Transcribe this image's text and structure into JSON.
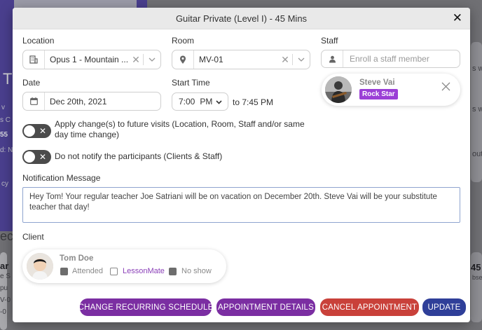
{
  "background": {
    "fragments": [
      "T",
      "v",
      "s C",
      "55",
      "d: N",
      "cy",
      "ec",
      "ar",
      "e S",
      "pu",
      "V-0",
      "-0",
      "s w",
      "s w",
      "out",
      "45",
      "bse"
    ]
  },
  "modal": {
    "title": "Guitar Private (Level I) - 45 Mins",
    "close_label": "✕",
    "location": {
      "label": "Location",
      "value": "Opus 1 - Mountain ...",
      "icon": "building-icon"
    },
    "room": {
      "label": "Room",
      "value": "MV-01",
      "icon": "map-pin-icon"
    },
    "staff": {
      "label": "Staff",
      "placeholder": "Enroll a staff member",
      "member": {
        "name": "Steve Vai",
        "badge": "Rock Star"
      }
    },
    "date": {
      "label": "Date",
      "value": "Dec 20th, 2021",
      "icon": "calendar-icon"
    },
    "start_time": {
      "label": "Start Time",
      "hour": "7:00",
      "ampm": "PM",
      "end_text": "to 7:45 PM"
    },
    "toggles": [
      {
        "label": "Apply change(s) to future visits (Location, Room, Staff and/or same day time change)",
        "on": false
      },
      {
        "label": "Do not notify the participants (Clients & Staff)",
        "on": false
      }
    ],
    "notification": {
      "label": "Notification Message",
      "text": "Hey Tom! Your regular teacher Joe Satriani will be on vacation on December 20th. Steve Vai will be your substitute teacher that day!"
    },
    "client": {
      "label": "Client",
      "name": "Tom Doe",
      "options": [
        {
          "label": "Attended",
          "checked": true
        },
        {
          "label": "LessonMate",
          "checked": false
        },
        {
          "label": "No show",
          "checked": true
        }
      ]
    },
    "buttons": [
      {
        "label": "CHANGE RECURRING SCHEDULE",
        "color": "#7b2ea2"
      },
      {
        "label": "APPOINTMENT DETAILS",
        "color": "#7b2ea2"
      },
      {
        "label": "CANCEL APPOINTMENT",
        "color": "#c9413a"
      },
      {
        "label": "UPDATE",
        "color": "#2f3f99"
      }
    ]
  },
  "colors": {
    "accent": "#7b2ea2",
    "danger": "#c9413a",
    "primary": "#2f3f99",
    "badge": "#9b3fd6"
  }
}
